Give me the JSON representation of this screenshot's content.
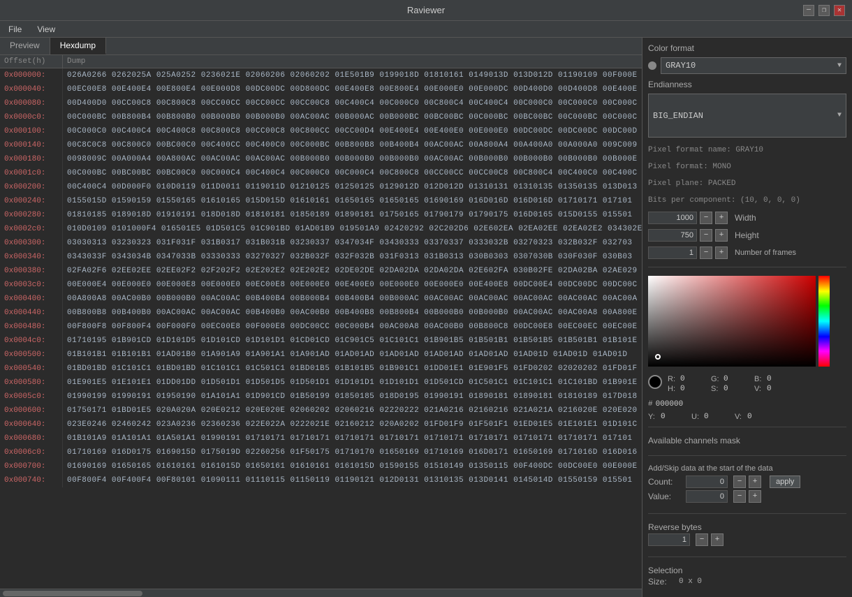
{
  "app": {
    "title": "Raviewer",
    "menu": [
      "File",
      "View"
    ]
  },
  "title_controls": [
    "—",
    "❐",
    "✕"
  ],
  "tabs": [
    {
      "label": "Preview",
      "active": false
    },
    {
      "label": "Hexdump",
      "active": true
    }
  ],
  "hexdump": {
    "header_offset": "Offset(h)",
    "header_dump": "Dump",
    "rows": [
      {
        "offset": "0x000000:",
        "data": "026A0266  0262025A  025A0252  0236021E  02060206  02060202  01E501B9  0199018D  01810161  0149013D  013D012D  01190109  00F000E"
      },
      {
        "offset": "0x000040:",
        "data": "00EC00E8  00E400E4  00E800E4  00E000D8  00DC00DC  00D800DC  00E400E8  00E800E4  00E000E0  00E000DC  00D400D0  00D400D8  00E400E"
      },
      {
        "offset": "0x000080:",
        "data": "00D400D0  00CC00C8  00C800C8  00CC00CC  00CC00CC  00CC00C8  00C400C4  00C000C0  00C800C4  00C400C4  00C000C0  00C000C0  00C000C"
      },
      {
        "offset": "0x0000c0:",
        "data": "00C000BC  00B800B4  00B800B0  00B000B0  00B000B0  00AC00AC  00B000AC  00B000BC  00BC00BC  00C000BC  00BC00BC  00C000BC  00C000C"
      },
      {
        "offset": "0x000100:",
        "data": "00C000C0  00C400C4  00C400C8  00C800C8  00CC00C8  00C800CC  00CC00D4  00E400E4  00E400E0  00E000E0  00DC00DC  00DC00DC  00DC00D"
      },
      {
        "offset": "0x000140:",
        "data": "00C8C0C8  00C800C0  00BC00C0  00C400CC  00C400C0  00C000BC  00B800B8  00B400B4  00AC00AC  00A800A4  00A400A0  00A000A0  009C009"
      },
      {
        "offset": "0x000180:",
        "data": "0098009C  00A000A4  00A800AC  00AC00AC  00AC00AC  00B000B0  00B000B0  00B000B0  00AC00AC  00B000B0  00B000B0  00B000B0  00B000E"
      },
      {
        "offset": "0x0001c0:",
        "data": "00C000BC  00BC00BC  00BC00C0  00C000C4  00C400C4  00C000C0  00C000C4  00C800C8  00CC00CC  00CC00C8  00C800C4  00C400C0  00C400C"
      },
      {
        "offset": "0x000200:",
        "data": "00C400C4  00D000F0  010D0119  011D0011  0119011D  01210125  01250125  0129012D  012D012D  01310131  01310135  01350135  013D013"
      },
      {
        "offset": "0x000240:",
        "data": "0155015D  01590159  01550165  01610165  015D015D  01610161  01650165  01650165  01690169  016D016D  016D016D  01710171  017101"
      },
      {
        "offset": "0x000280:",
        "data": "01810185  0189018D  01910191  018D018D  01810181  01850189  01890181  01750165  01790179  01790175  016D0165  015D0155  015501"
      },
      {
        "offset": "0x0002c0:",
        "data": "010D0109  0101000F4  016501E5  01D501C5  01C901BD  01AD01B9  019501A9  02420292  02C202D6  02E602EA  02EA02EE  02EA02E2  034302E"
      },
      {
        "offset": "0x000300:",
        "data": "03030313  03230323  031F031F  031B0317  031B031B  03230337  0347034F  03430333  03370337  0333032B  03270323  032B032F  032703"
      },
      {
        "offset": "0x000340:",
        "data": "0343033F  0343034B  0347033B  03330333  03270327  032B032F  032F032B  031F0313  031B0313  030B0303  0307030B  030F030F  030B03"
      },
      {
        "offset": "0x000380:",
        "data": "02FA02F6  02EE02EE  02EE02F2  02F202F2  02E202E2  02E202E2  02DE02DE  02DA02DA  02DA02DA  02E602FA  030B02FE  02DA02BA  02AE029"
      },
      {
        "offset": "0x0003c0:",
        "data": "00E000E4  00E000E0  00E000E8  00E000E0  00EC00E8  00E000E0  00E400E0  00E000E0  00E000E0  00E400E8  00DC00E4  00DC00DC  00DC00C"
      },
      {
        "offset": "0x000400:",
        "data": "00A800A8  00AC00B0  00B000B0  00AC00AC  00B400B4  00B000B4  00B400B4  00B000AC  00AC00AC  00AC00AC  00AC00AC  00AC00AC  00AC00A"
      },
      {
        "offset": "0x000440:",
        "data": "00B800B8  00B400B0  00AC00AC  00AC00AC  00B400B0  00AC00B0  00B400B8  00B800B4  00B000B0  00B000B0  00AC00AC  00AC00A8  00A800E"
      },
      {
        "offset": "0x000480:",
        "data": "00F800F8  00F800F4  00F000F0  00EC00E8  00F000E8  00DC00CC  00C000B4  00AC00A8  00AC00B0  00B800C8  00DC00E8  00EC00EC  00EC00E"
      },
      {
        "offset": "0x0004c0:",
        "data": "01710195  01B901CD  01D101D5  01D101CD  01D101D1  01CD01CD  01C901C5  01C101C1  01B901B5  01B501B1  01B501B5  01B501B1  01B101E"
      },
      {
        "offset": "0x000500:",
        "data": "01B101B1  01B101B1  01AD01B0  01A901A9  01A901A1  01A901AD  01AD01AD  01AD01AD  01AD01AD  01AD01AD  01AD01D  01AD01D  01AD01D"
      },
      {
        "offset": "0x000540:",
        "data": "01BD01BD  01C101C1  01BD01BD  01C101C1  01C501C1  01BD01B5  01B101B5  01B901C1  01DD01E1  01E901F5  01FD0202  02020202  01FD01F"
      },
      {
        "offset": "0x000580:",
        "data": "01E901E5  01E101E1  01DD01DD  01D501D1  01D501D5  01D501D1  01D101D1  01D101D1  01D501CD  01C501C1  01C101C1  01C101BD  01B901E"
      },
      {
        "offset": "0x0005c0:",
        "data": "01990199  01990191  01950190  01A101A1  01D901CD  01B50199  01850185  018D0195  01990191  01890181  01890181  01810189  017D018"
      },
      {
        "offset": "0x000600:",
        "data": "01750171  01BD01E5  020A020A  020E0212  020E020E  02060202  02060216  02220222  021A0216  02160216  021A021A  0216020E  020E020"
      },
      {
        "offset": "0x000640:",
        "data": "023E0246  02460242  023A0236  02360236  022E022A  0222021E  02160212  020A0202  01FD01F9  01F501F1  01ED01E5  01E101E1  01D101C"
      },
      {
        "offset": "0x000680:",
        "data": "01B101A9  01A101A1  01A501A1  01990191  01710171  01710171  01710171  01710171  01710171  01710171  01710171  01710171  017101"
      },
      {
        "offset": "0x0006c0:",
        "data": "01710169  016D0175  0169015D  0175019D  02260256  01F50175  01710170  01650169  01710169  016D0171  01650169  0171016D  016D016"
      },
      {
        "offset": "0x000700:",
        "data": "01690169  01650165  01610161  0161015D  01650161  01610161  0161015D  01590155  01510149  01350115  00F400DC  00DC00E0  00E000E"
      },
      {
        "offset": "0x000740:",
        "data": "00F800F4  00F400F4  00F80101  01090111  01110115  01150119  01190121  012D0131  01310135  013D0141  0145014D  01550159  015501"
      }
    ]
  },
  "right_panel": {
    "color_format_label": "Color format",
    "color_format_value": "GRAY10",
    "endianness_label": "Endianness",
    "endianness_value": "BIG_ENDIAN",
    "pixel_info": "Pixel format name:  GRAY10\nPixel format: MONO\nPixel plane:  PACKED\nBits per component:  (10, 0, 0, 0)",
    "pixel_format_name": "Pixel format name:  GRAY10",
    "pixel_format": "Pixel format: MONO",
    "pixel_plane": "Pixel plane:  PACKED",
    "bits_per_component": "Bits per component:  (10, 0, 0, 0)",
    "width_label": "Width",
    "width_value": "1000",
    "height_label": "Height",
    "height_value": "750",
    "frames_label": "Number of frames",
    "frames_value": "1",
    "r_label": "R:",
    "r_value": "0",
    "g_label": "G:",
    "g_value": "0",
    "b_label": "B:",
    "b_value": "0",
    "h_label": "H:",
    "h_value": "0",
    "s_label": "S:",
    "s_value": "0",
    "v_label": "V:",
    "v_value": "0",
    "hex_hash": "#",
    "hex_color": "000000",
    "y_label": "Y:",
    "y_value": "0",
    "u_label": "U:",
    "u_value": "0",
    "yuv_v_label": "V:",
    "yuv_v_value": "0",
    "channels_mask_label": "Available channels mask",
    "add_skip_label": "Add/Skip data at the start of the data",
    "count_label": "Count:",
    "count_value": "0",
    "value_label": "Value:",
    "value_value": "0",
    "apply_label": "apply",
    "reverse_bytes_label": "Reverse bytes",
    "reverse_bytes_value": "1",
    "selection_label": "Selection",
    "size_label": "Size:",
    "size_value": "0 x 0",
    "minus": "−",
    "plus": "+"
  }
}
